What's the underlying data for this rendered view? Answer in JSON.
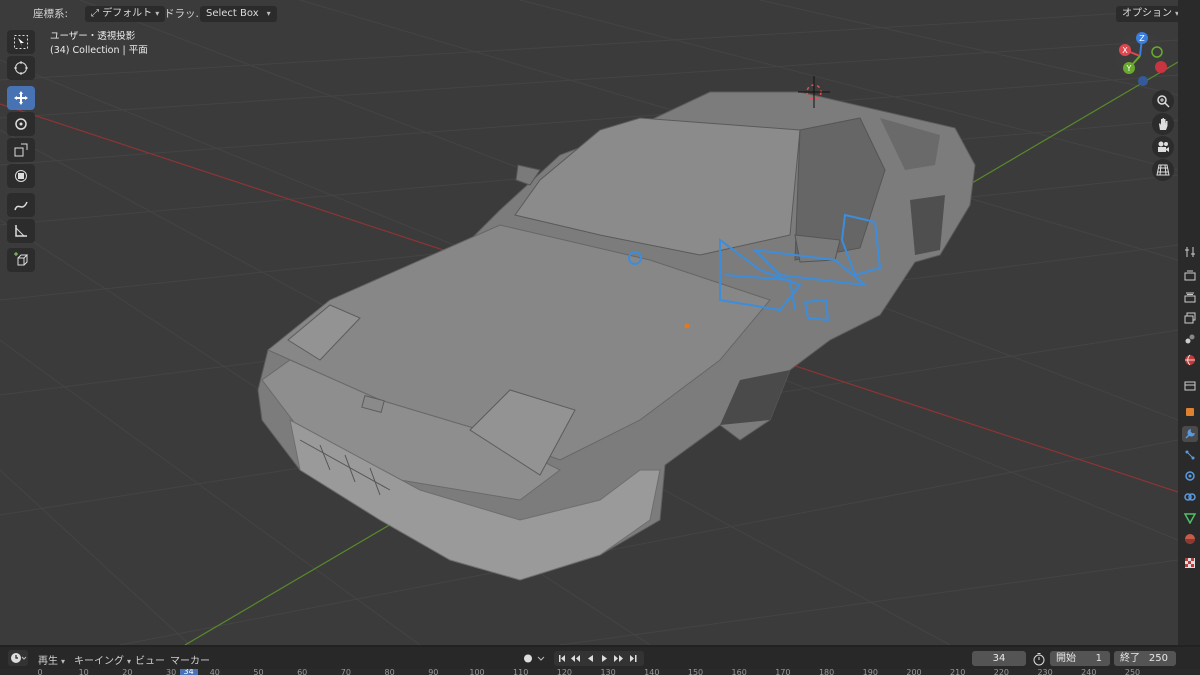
{
  "header": {
    "coord_label": "座標系:",
    "coord_value": "デフォルト",
    "drag_label": "ドラッ...",
    "select_mode": "Select Box",
    "options_label": "オプション"
  },
  "overlay": {
    "view_name": "ユーザー・透視投影",
    "collection": "(34) Collection | 平面"
  },
  "toolbar": {
    "tools": [
      "select-box",
      "cursor",
      "move",
      "rotate",
      "scale",
      "transform",
      "annotate",
      "measure",
      "add-cube"
    ],
    "active_tool": "move"
  },
  "gizmo": {
    "axis_x": "X",
    "axis_y": "Y",
    "axis_z": "Z",
    "colors": {
      "x": "#e0464f",
      "y": "#6aa92f",
      "z": "#3a7fe0"
    }
  },
  "nav_buttons": [
    "zoom-icon",
    "hand-icon",
    "camera-icon",
    "grid-icon"
  ],
  "properties_tabs": [
    "tool-icon",
    "render-icon",
    "output-icon",
    "view-layer-icon",
    "scene-icon",
    "world-icon",
    "collection-icon",
    "object-icon",
    "modifier-icon",
    "particles-icon",
    "physics-icon",
    "constraints-icon",
    "data-icon",
    "material-icon",
    "texture-icon"
  ],
  "properties_active": "modifier-icon",
  "timeline": {
    "playback_label": "再生",
    "keying_label": "キーイング",
    "view_label": "ビュー",
    "marker_label": "マーカー",
    "current_frame": "34",
    "start_label": "開始",
    "start_value": "1",
    "end_label": "終了",
    "end_value": "250",
    "ruler_ticks": [
      "0",
      "10",
      "20",
      "30",
      "34",
      "40",
      "50",
      "60",
      "70",
      "80",
      "90",
      "100",
      "110",
      "120",
      "130",
      "140",
      "150",
      "160",
      "170",
      "180",
      "190",
      "200",
      "210",
      "220",
      "230",
      "240",
      "250"
    ]
  },
  "colors": {
    "accent": "#4772b3",
    "viewport_bg": "#3b3b3b",
    "selection": "#3c8ddc",
    "x_axis_line": "#8e3434",
    "y_axis_line": "#5a8a2a"
  }
}
